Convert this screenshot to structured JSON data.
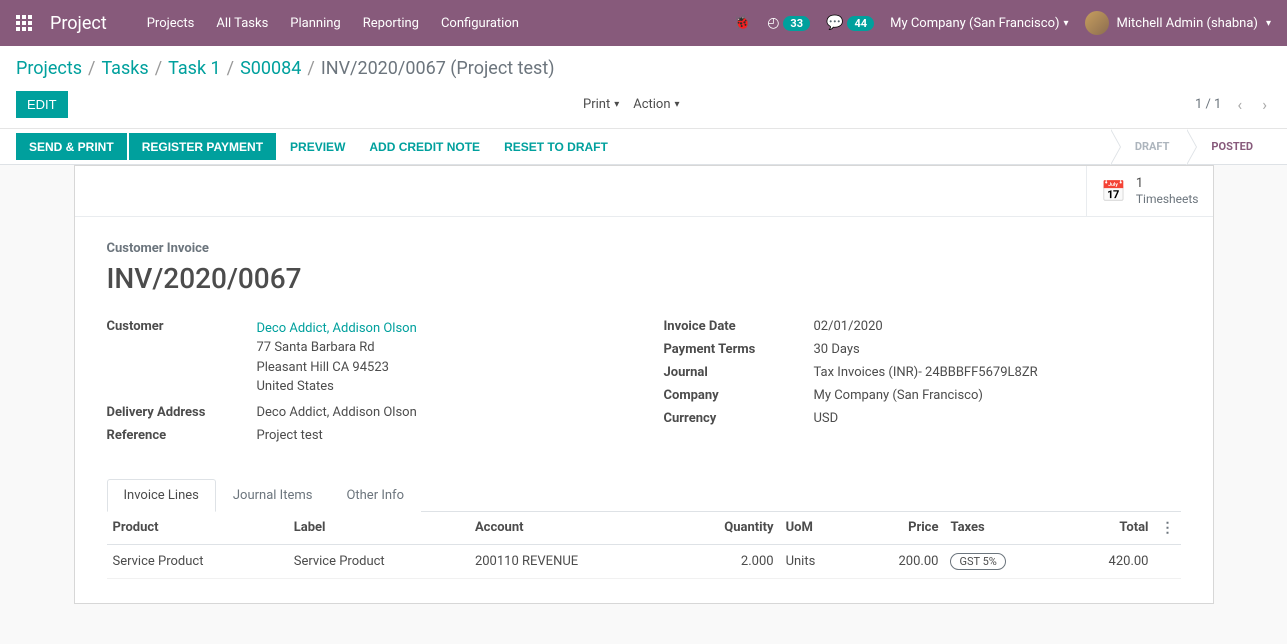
{
  "nav": {
    "brand": "Project",
    "menu": [
      "Projects",
      "All Tasks",
      "Planning",
      "Reporting",
      "Configuration"
    ],
    "badge1": "33",
    "badge2": "44",
    "company": "My Company (San Francisco)",
    "user": "Mitchell Admin (shabna)"
  },
  "breadcrumb": {
    "items": [
      "Projects",
      "Tasks",
      "Task 1",
      "S00084"
    ],
    "current": "INV/2020/0067 (Project test)"
  },
  "cp": {
    "edit": "EDIT",
    "print": "Print",
    "action": "Action",
    "pager": "1 / 1"
  },
  "buttons": {
    "send_print": "SEND & PRINT",
    "register_payment": "REGISTER PAYMENT",
    "preview": "PREVIEW",
    "add_credit": "ADD CREDIT NOTE",
    "reset_draft": "RESET TO DRAFT"
  },
  "status": {
    "draft": "DRAFT",
    "posted": "POSTED"
  },
  "stat": {
    "val": "1",
    "label": "Timesheets"
  },
  "header": {
    "label": "Customer Invoice",
    "title": "INV/2020/0067"
  },
  "fields": {
    "customer_l": "Customer",
    "customer_v": "Deco Addict, Addison Olson",
    "addr1": "77 Santa Barbara Rd",
    "addr2": "Pleasant Hill CA 94523",
    "addr3": "United States",
    "delivery_l": "Delivery Address",
    "delivery_v": "Deco Addict, Addison Olson",
    "ref_l": "Reference",
    "ref_v": "Project test",
    "invdate_l": "Invoice Date",
    "invdate_v": "02/01/2020",
    "payterm_l": "Payment Terms",
    "payterm_v": "30 Days",
    "journal_l": "Journal",
    "journal_v": "Tax Invoices (INR)- 24BBBFF5679L8ZR",
    "company_l": "Company",
    "company_v": "My Company (San Francisco)",
    "currency_l": "Currency",
    "currency_v": "USD"
  },
  "tabs": {
    "t1": "Invoice Lines",
    "t2": "Journal Items",
    "t3": "Other Info"
  },
  "table": {
    "h_product": "Product",
    "h_label": "Label",
    "h_account": "Account",
    "h_qty": "Quantity",
    "h_uom": "UoM",
    "h_price": "Price",
    "h_taxes": "Taxes",
    "h_total": "Total",
    "r_product": "Service Product",
    "r_label": "Service Product",
    "r_account": "200110 REVENUE",
    "r_qty": "2.000",
    "r_uom": "Units",
    "r_price": "200.00",
    "r_tax": "GST 5%",
    "r_total": "420.00"
  }
}
